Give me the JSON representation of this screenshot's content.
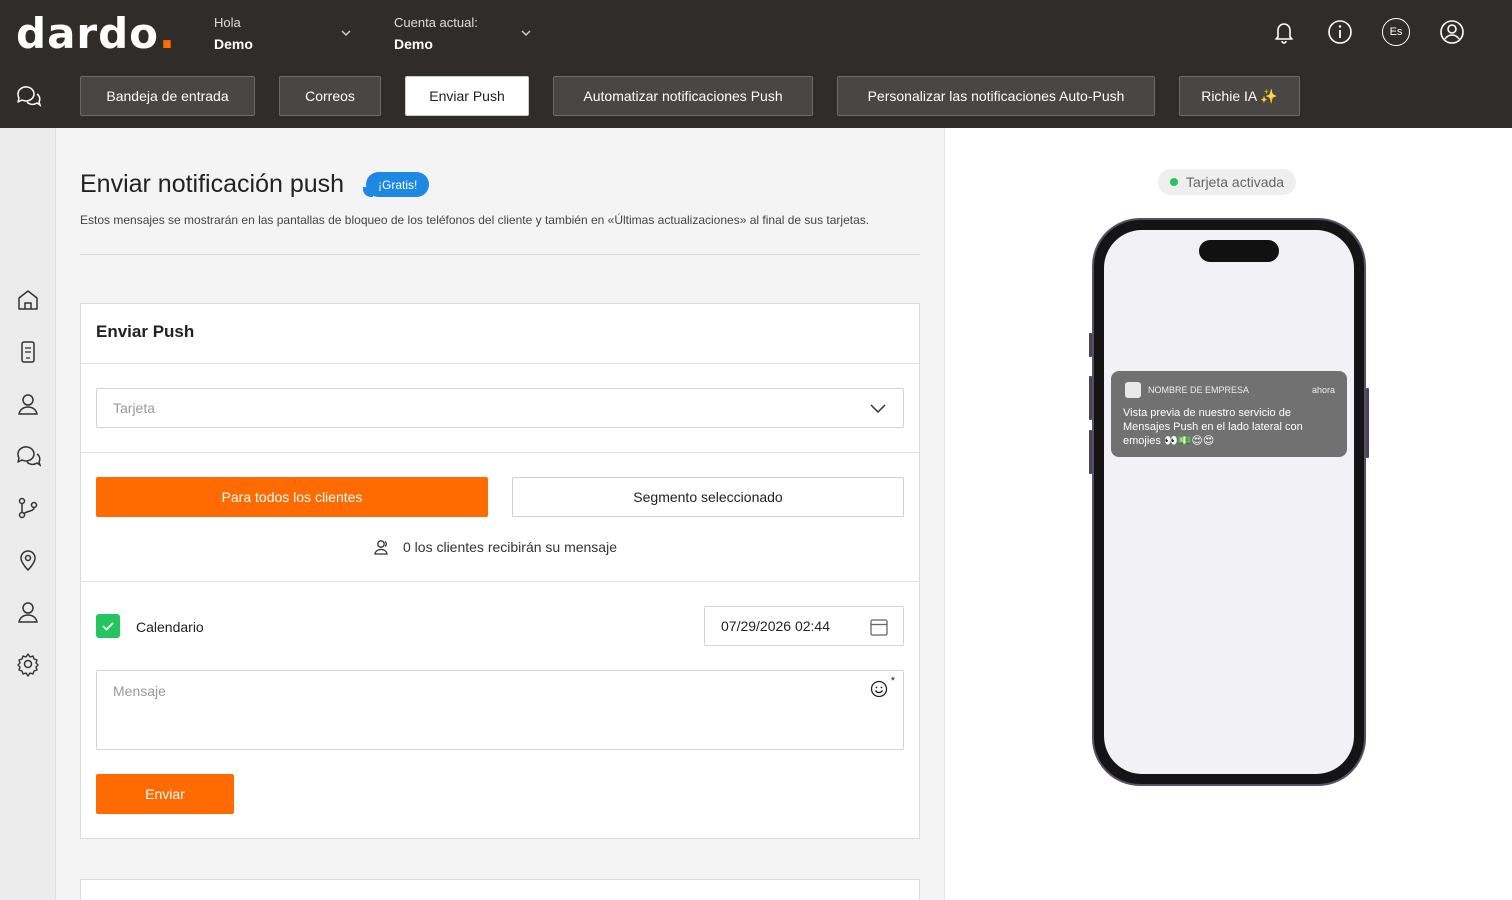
{
  "header": {
    "logo": "dardo",
    "greeting_label": "Hola",
    "greeting_name": "Demo",
    "account_label": "Cuenta actual:",
    "account_name": "Demo",
    "language": "Es"
  },
  "tabs": [
    {
      "label": "Bandeja de entrada"
    },
    {
      "label": "Correos"
    },
    {
      "label": "Enviar Push"
    },
    {
      "label": "Automatizar notificaciones Push"
    },
    {
      "label": "Personalizar las notificaciones Auto-Push"
    },
    {
      "label": "Richie IA ✨"
    }
  ],
  "active_tab": "Enviar Push",
  "page": {
    "title": "Enviar notificación push",
    "badge": "¡Gratis!",
    "subtitle": "Estos mensajes se mostrarán en las pantallas de bloqueo de los teléfonos del cliente y también en «Últimas actualizaciones» al final de sus tarjetas."
  },
  "form": {
    "title": "Enviar Push",
    "card_placeholder": "Tarjeta",
    "all_clients_button": "Para todos los clientes",
    "segment_button": "Segmento seleccionado",
    "recipients_text": "0 los clientes recibirán su mensaje",
    "calendar_label": "Calendario",
    "calendar_checked": true,
    "date_value": "07/29/2026 02:44",
    "message_placeholder": "Mensaje",
    "required_mark": "*",
    "send_button": "Enviar"
  },
  "preview": {
    "status": "Tarjeta activada",
    "notification": {
      "app_name": "NOMBRE DE EMPRESA",
      "time": "ahora",
      "text": "Vista previa de nuestro servicio de Mensajes Push en el lado lateral con emojies 👀💵😍😍"
    }
  },
  "colors": {
    "header_bg": "#302c29",
    "accent": "#ff6b00",
    "badge": "#1e88e5",
    "success": "#22c55e"
  }
}
